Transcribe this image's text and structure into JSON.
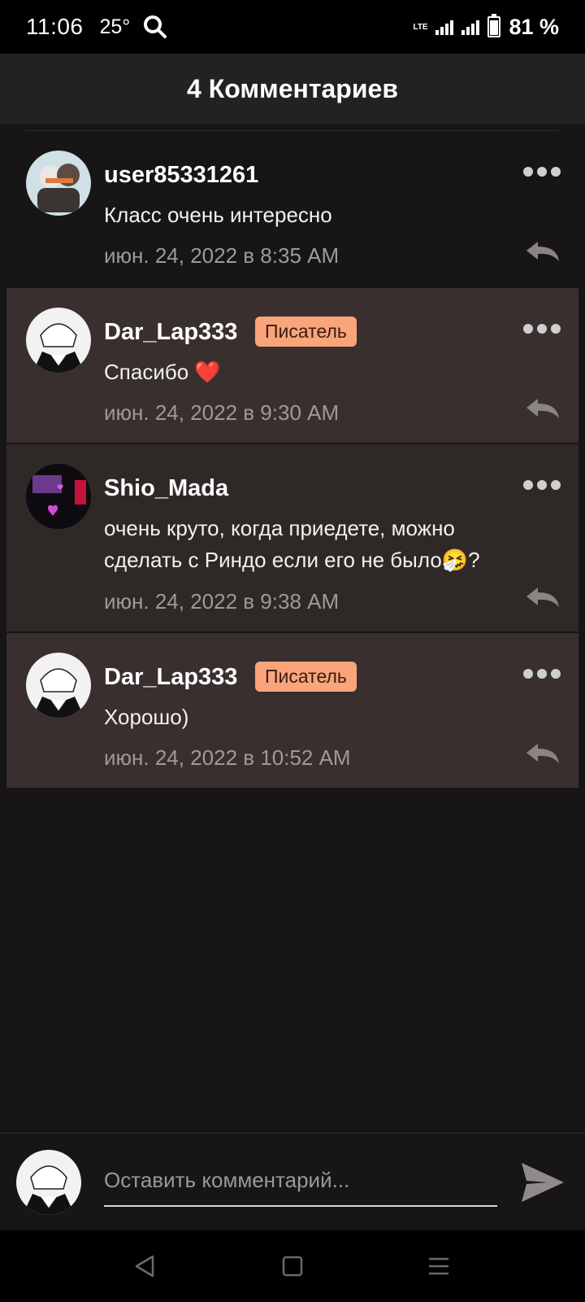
{
  "status_bar": {
    "time": "11:06",
    "temperature": "25°",
    "network": "LTE",
    "battery_percent": "81 %",
    "battery_level": 0.81
  },
  "header": {
    "title": "4 Комментариев"
  },
  "comments": [
    {
      "username": "user85331261",
      "badge": "",
      "text": "Класс очень интересно",
      "timestamp": "июн. 24, 2022 в 8:35 AM"
    },
    {
      "username": "Dar_Lap333",
      "badge": "Писатель",
      "text": "Спасибо ❤️",
      "timestamp": "июн. 24, 2022 в 9:30 AM"
    },
    {
      "username": "Shio_Mada",
      "badge": "",
      "text": "очень круто, когда приедете, можно сделать с Риндо если его не было🤧?",
      "timestamp": "июн. 24, 2022 в 9:38 AM"
    },
    {
      "username": "Dar_Lap333",
      "badge": "Писатель",
      "text": "Хорошо)",
      "timestamp": "июн. 24, 2022 в 10:52 AM"
    }
  ],
  "input": {
    "placeholder": "Оставить комментарий..."
  },
  "icons": {
    "more": "more-options-icon",
    "reply": "reply-icon",
    "send": "send-icon",
    "back": "back-triangle-icon",
    "home": "home-square-icon",
    "recents": "recents-menu-icon"
  },
  "colors": {
    "writer_badge": "#f9a47b",
    "highlight_bg": "#3a2f2f",
    "background": "#171516"
  }
}
